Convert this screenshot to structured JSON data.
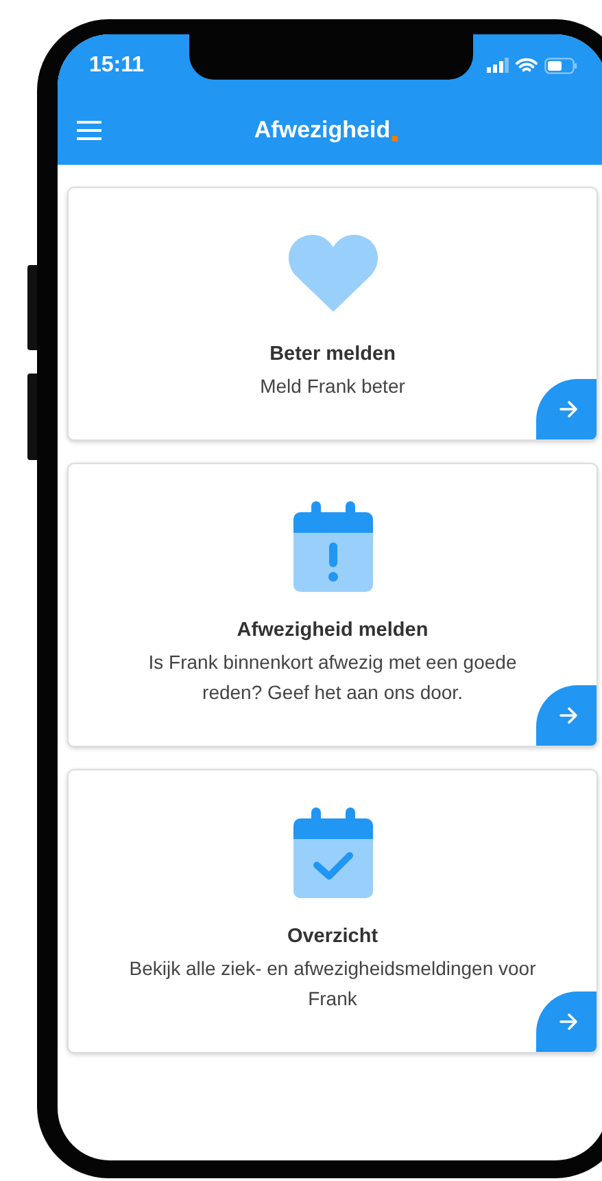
{
  "status_bar": {
    "time": "15:11"
  },
  "header": {
    "title": "Afwezigheid"
  },
  "cards": [
    {
      "kind": "heart",
      "title": "Beter melden",
      "description": "Meld Frank beter"
    },
    {
      "kind": "calendar-alert",
      "title": "Afwezigheid melden",
      "description": "Is Frank binnenkort afwezig met een goede reden? Geef het aan ons door."
    },
    {
      "kind": "calendar-check",
      "title": "Overzicht",
      "description": "Bekijk alle ziek- en afwezigheidsmeldingen voor Frank"
    }
  ]
}
